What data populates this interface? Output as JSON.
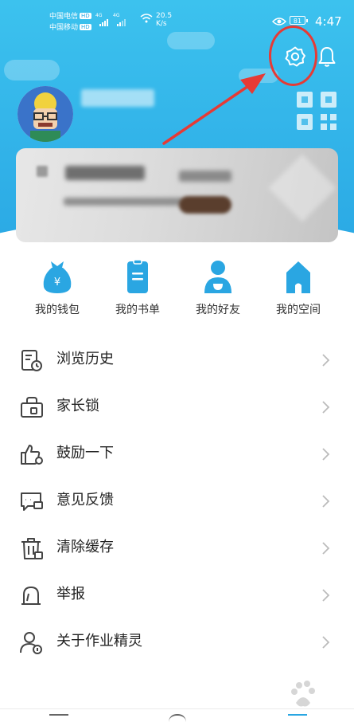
{
  "status_bar": {
    "carrier1": "中国电信",
    "carrier2": "中国移动",
    "hd": "HD",
    "net": "4G",
    "speed_value": "20.5",
    "speed_unit": "K/s",
    "battery": "81",
    "time": "4:47"
  },
  "header": {
    "settings_icon": "gear-icon",
    "bell_icon": "bell-icon",
    "annotation_color": "#e63a35"
  },
  "quick_links": [
    {
      "label": "我的钱包",
      "icon": "wallet-icon"
    },
    {
      "label": "我的书单",
      "icon": "booklist-icon"
    },
    {
      "label": "我的好友",
      "icon": "friends-icon"
    },
    {
      "label": "我的空间",
      "icon": "home-space-icon"
    }
  ],
  "menu": [
    {
      "label": "浏览历史",
      "icon": "history-icon"
    },
    {
      "label": "家长锁",
      "icon": "parent-lock-icon"
    },
    {
      "label": "鼓励一下",
      "icon": "thumbs-up-icon"
    },
    {
      "label": "意见反馈",
      "icon": "feedback-icon"
    },
    {
      "label": "清除缓存",
      "icon": "trash-icon"
    },
    {
      "label": "举报",
      "icon": "report-icon"
    },
    {
      "label": "关于作业精灵",
      "icon": "about-icon"
    }
  ],
  "theme": {
    "header_blue": "#34b6ea",
    "icon_blue": "#2aa6e2"
  }
}
